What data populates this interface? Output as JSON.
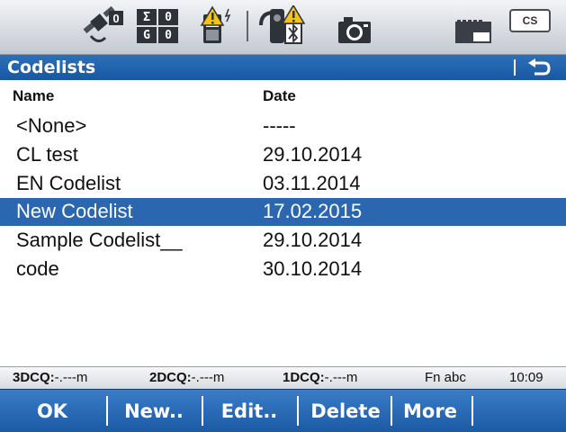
{
  "title": "Codelists",
  "status_icons": {
    "satellite": "satellite-icon",
    "satellite_count": "0",
    "counter": {
      "sigma": "Σ",
      "sigma_value": "0",
      "g": "G",
      "g_value": "0"
    },
    "warning": "controller-warning-icon",
    "instrument": "instrument-bluetooth-warning-icon",
    "camera": "camera-icon",
    "memory": "memory-card-icon",
    "battery_label": "CS"
  },
  "columns": {
    "name": "Name",
    "date": "Date"
  },
  "rows": [
    {
      "name": "<None>",
      "date": "-----"
    },
    {
      "name": "CL test",
      "date": "29.10.2014"
    },
    {
      "name": "EN Codelist",
      "date": "03.11.2014"
    },
    {
      "name": "New Codelist",
      "date": "17.02.2015",
      "selected": true
    },
    {
      "name": "Sample Codelist__",
      "date": "29.10.2014"
    },
    {
      "name": "code",
      "date": "30.10.2014"
    }
  ],
  "statusline": {
    "q3_label": "3DCQ:",
    "q3_value": "-.---m",
    "q2_label": "2DCQ:",
    "q2_value": "-.---m",
    "q1_label": "1DCQ:",
    "q1_value": "-.---m",
    "mode": "Fn  abc",
    "time": "10:09"
  },
  "fkeys": {
    "f1": "OK",
    "f2": "New..",
    "f3": "Edit..",
    "f4": "Delete",
    "f5": "More",
    "f6": ""
  },
  "colors": {
    "title_bg": "#1f63ad",
    "selection": "#2a67b0",
    "fkey_bg": "#2a6bb6"
  }
}
